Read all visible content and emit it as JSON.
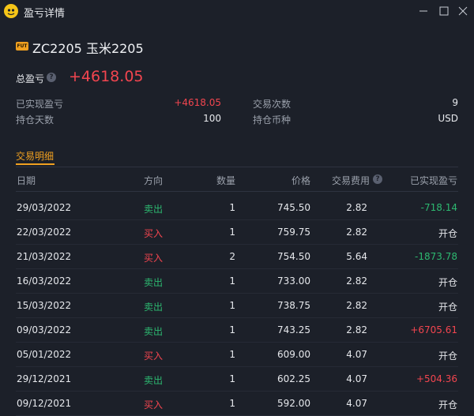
{
  "window": {
    "title": "盈亏详情",
    "minimize_icon": "minimize-icon",
    "maximize_icon": "maximize-icon",
    "close_icon": "close-icon"
  },
  "instrument": {
    "badge": "FUT",
    "name": "ZC2205 玉米2205"
  },
  "summary": {
    "total_label": "总盈亏",
    "total_value": "+4618.05",
    "stats": [
      {
        "label": "已实现盈亏",
        "value": "+4618.05",
        "color": "#f2454f"
      },
      {
        "label": "交易次数",
        "value": "9"
      },
      {
        "label": "持仓天数",
        "value": "100"
      },
      {
        "label": "持仓币种",
        "value": "USD"
      }
    ]
  },
  "tabs": [
    {
      "label": "交易明细",
      "active": true
    }
  ],
  "table": {
    "headers": [
      "日期",
      "方向",
      "数量",
      "价格",
      "交易费用",
      "已实现盈亏"
    ],
    "rows": [
      {
        "date": "29/03/2022",
        "direction": "卖出",
        "qty": "1",
        "price": "745.50",
        "fee": "2.82",
        "pnl": "-718.14",
        "dir_color": "green",
        "pnl_color": "green"
      },
      {
        "date": "22/03/2022",
        "direction": "买入",
        "qty": "1",
        "price": "759.75",
        "fee": "2.82",
        "pnl": "开仓",
        "dir_color": "red",
        "pnl_color": ""
      },
      {
        "date": "21/03/2022",
        "direction": "买入",
        "qty": "2",
        "price": "754.50",
        "fee": "5.64",
        "pnl": "-1873.78",
        "dir_color": "red",
        "pnl_color": "green"
      },
      {
        "date": "16/03/2022",
        "direction": "卖出",
        "qty": "1",
        "price": "733.00",
        "fee": "2.82",
        "pnl": "开仓",
        "dir_color": "green",
        "pnl_color": ""
      },
      {
        "date": "15/03/2022",
        "direction": "卖出",
        "qty": "1",
        "price": "738.75",
        "fee": "2.82",
        "pnl": "开仓",
        "dir_color": "green",
        "pnl_color": ""
      },
      {
        "date": "09/03/2022",
        "direction": "卖出",
        "qty": "1",
        "price": "743.25",
        "fee": "2.82",
        "pnl": "+6705.61",
        "dir_color": "green",
        "pnl_color": "red"
      },
      {
        "date": "05/01/2022",
        "direction": "买入",
        "qty": "1",
        "price": "609.00",
        "fee": "4.07",
        "pnl": "开仓",
        "dir_color": "red",
        "pnl_color": ""
      },
      {
        "date": "29/12/2021",
        "direction": "卖出",
        "qty": "1",
        "price": "602.25",
        "fee": "4.07",
        "pnl": "+504.36",
        "dir_color": "green",
        "pnl_color": "red"
      },
      {
        "date": "09/12/2021",
        "direction": "买入",
        "qty": "1",
        "price": "592.00",
        "fee": "4.07",
        "pnl": "开仓",
        "dir_color": "red",
        "pnl_color": ""
      }
    ]
  },
  "colors": {
    "background": "#1c2029",
    "accent": "#f0a020",
    "up": "#f2454f",
    "down": "#2db870"
  }
}
